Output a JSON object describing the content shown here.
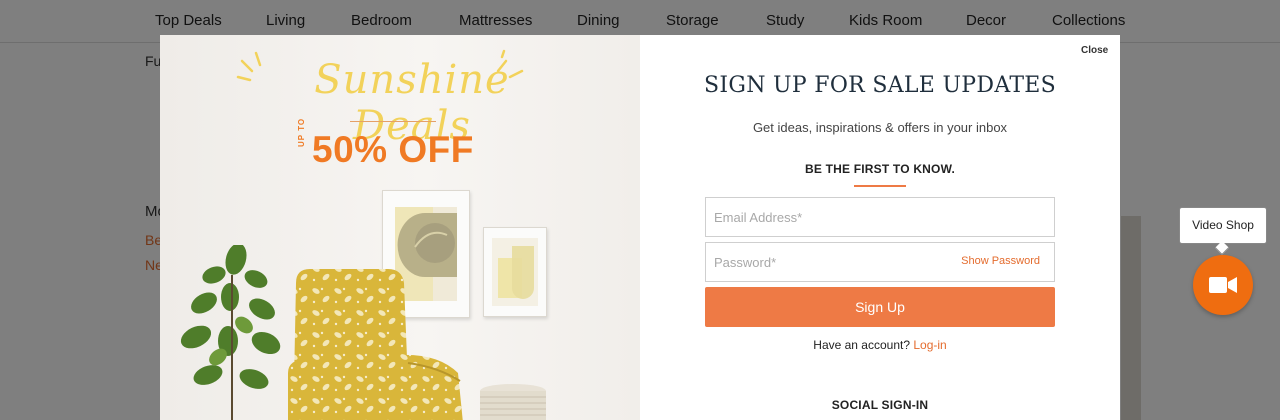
{
  "nav": {
    "items": [
      {
        "label": "Top Deals"
      },
      {
        "label": "Living"
      },
      {
        "label": "Bedroom"
      },
      {
        "label": "Mattresses"
      },
      {
        "label": "Dining"
      },
      {
        "label": "Storage"
      },
      {
        "label": "Study"
      },
      {
        "label": "Kids Room"
      },
      {
        "label": "Decor"
      },
      {
        "label": "Collections"
      }
    ]
  },
  "background": {
    "fragment_1": "Fu",
    "fragment_2": "Mo",
    "link_1": "Be",
    "link_2": "Ne"
  },
  "promo": {
    "script_title": "Sunshine Deals",
    "up_to": "UP TO",
    "discount": "50% OFF",
    "script_color": "#f2d25a",
    "accent_color": "#f07a24"
  },
  "signup": {
    "close_label": "Close",
    "title": "SIGN UP FOR SALE UPDATES",
    "subtitle": "Get ideas, inspirations & offers in your inbox",
    "first_to_know": "BE THE FIRST TO KNOW.",
    "email_placeholder": "Email Address*",
    "password_placeholder": "Password*",
    "show_password": "Show Password",
    "button_label": "Sign Up",
    "have_account": "Have an account?",
    "login_link": "Log-in",
    "social_heading": "SOCIAL SIGN-IN",
    "accent_color": "#ee7a45"
  },
  "video_shop": {
    "label": "Video Shop",
    "icon": "video-camera-icon",
    "color": "#ef6d10"
  }
}
